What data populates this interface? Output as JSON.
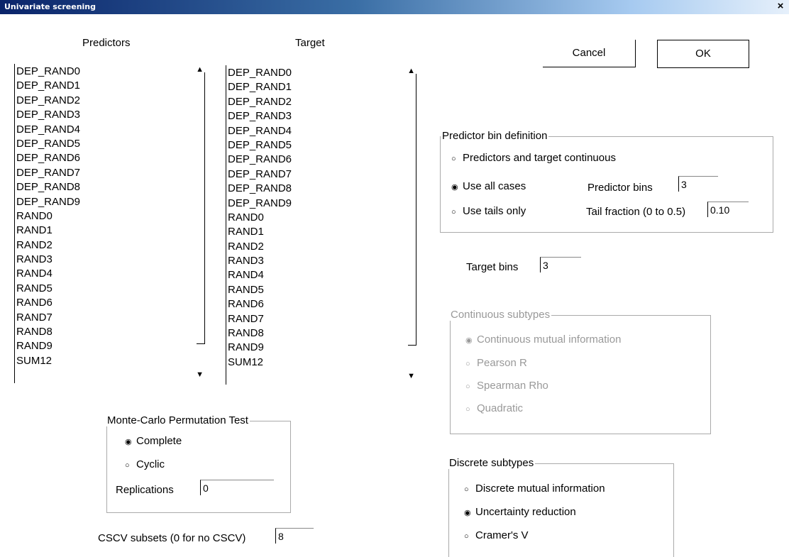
{
  "window": {
    "title": "Univariate screening",
    "close_glyph": "×"
  },
  "predictors": {
    "label": "Predictors",
    "items": [
      "DEP_RAND0",
      "DEP_RAND1",
      "DEP_RAND2",
      "DEP_RAND3",
      "DEP_RAND4",
      "DEP_RAND5",
      "DEP_RAND6",
      "DEP_RAND7",
      "DEP_RAND8",
      "DEP_RAND9",
      "RAND0",
      "RAND1",
      "RAND2",
      "RAND3",
      "RAND4",
      "RAND5",
      "RAND6",
      "RAND7",
      "RAND8",
      "RAND9",
      "SUM12"
    ]
  },
  "target": {
    "label": "Target",
    "items": [
      "DEP_RAND0",
      "DEP_RAND1",
      "DEP_RAND2",
      "DEP_RAND3",
      "DEP_RAND4",
      "DEP_RAND5",
      "DEP_RAND6",
      "DEP_RAND7",
      "DEP_RAND8",
      "DEP_RAND9",
      "RAND0",
      "RAND1",
      "RAND2",
      "RAND3",
      "RAND4",
      "RAND5",
      "RAND6",
      "RAND7",
      "RAND8",
      "RAND9",
      "SUM12"
    ]
  },
  "buttons": {
    "cancel": "Cancel",
    "ok": "OK"
  },
  "predictor_bin": {
    "legend": "Predictor bin definition",
    "opt_continuous": "Predictors and target continuous",
    "opt_all": "Use all cases",
    "opt_tails": "Use tails only",
    "predictor_bins_label": "Predictor bins",
    "predictor_bins_value": "3",
    "tail_fraction_label": "Tail fraction (0 to 0.5)",
    "tail_fraction_value": "0.10"
  },
  "target_bins": {
    "label": "Target bins",
    "value": "3"
  },
  "continuous": {
    "legend": "Continuous subtypes",
    "opt1": "Continuous mutual information",
    "opt2": "Pearson R",
    "opt3": "Spearman Rho",
    "opt4": "Quadratic"
  },
  "montecarlo": {
    "legend": "Monte-Carlo Permutation Test",
    "opt_complete": "Complete",
    "opt_cyclic": "Cyclic",
    "replications_label": "Replications",
    "replications_value": "0"
  },
  "discrete": {
    "legend": "Discrete subtypes",
    "opt1": "Discrete mutual information",
    "opt2": "Uncertainty reduction",
    "opt3": "Cramer's V"
  },
  "cscv": {
    "label": "CSCV subsets (0 for no CSCV)",
    "value": "8"
  },
  "glyphs": {
    "radio_on": "◉",
    "radio_off": "○",
    "arrow_up": "▲",
    "arrow_down": "▼"
  }
}
